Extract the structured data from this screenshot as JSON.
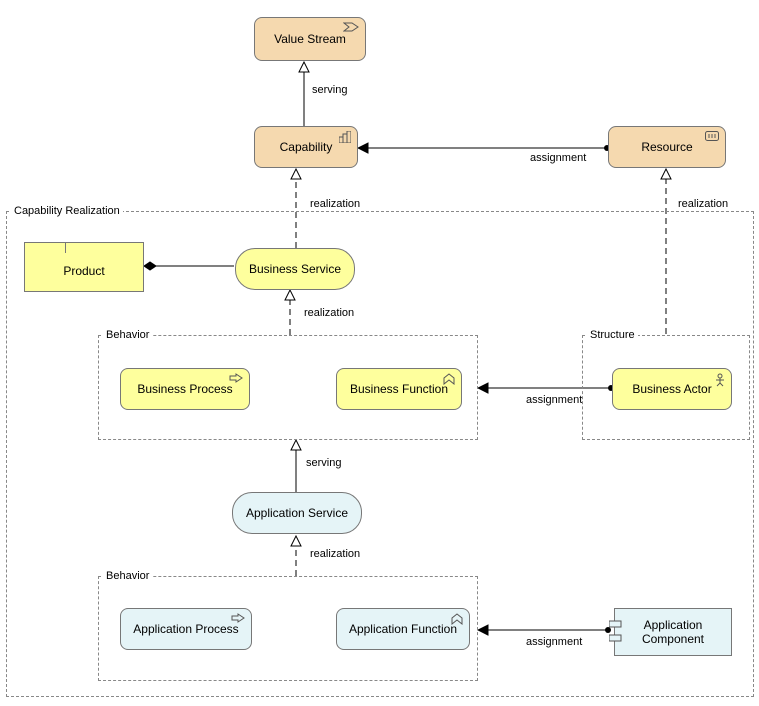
{
  "groups": {
    "capRealization": "Capability Realization",
    "behavior1": "Behavior",
    "behavior2": "Behavior",
    "structure": "Structure"
  },
  "nodes": {
    "valueStream": "Value Stream",
    "capability": "Capability",
    "resource": "Resource",
    "product": "Product",
    "bizService": "Business Service",
    "bizProcess": "Business Process",
    "bizFunction": "Business Function",
    "bizActor": "Business Actor",
    "appService": "Application Service",
    "appProcess": "Application Process",
    "appFunction": "Application Function",
    "appComponent": "Application\nComponent"
  },
  "rel": {
    "serving": "serving",
    "realization": "realization",
    "assignment": "assignment"
  }
}
